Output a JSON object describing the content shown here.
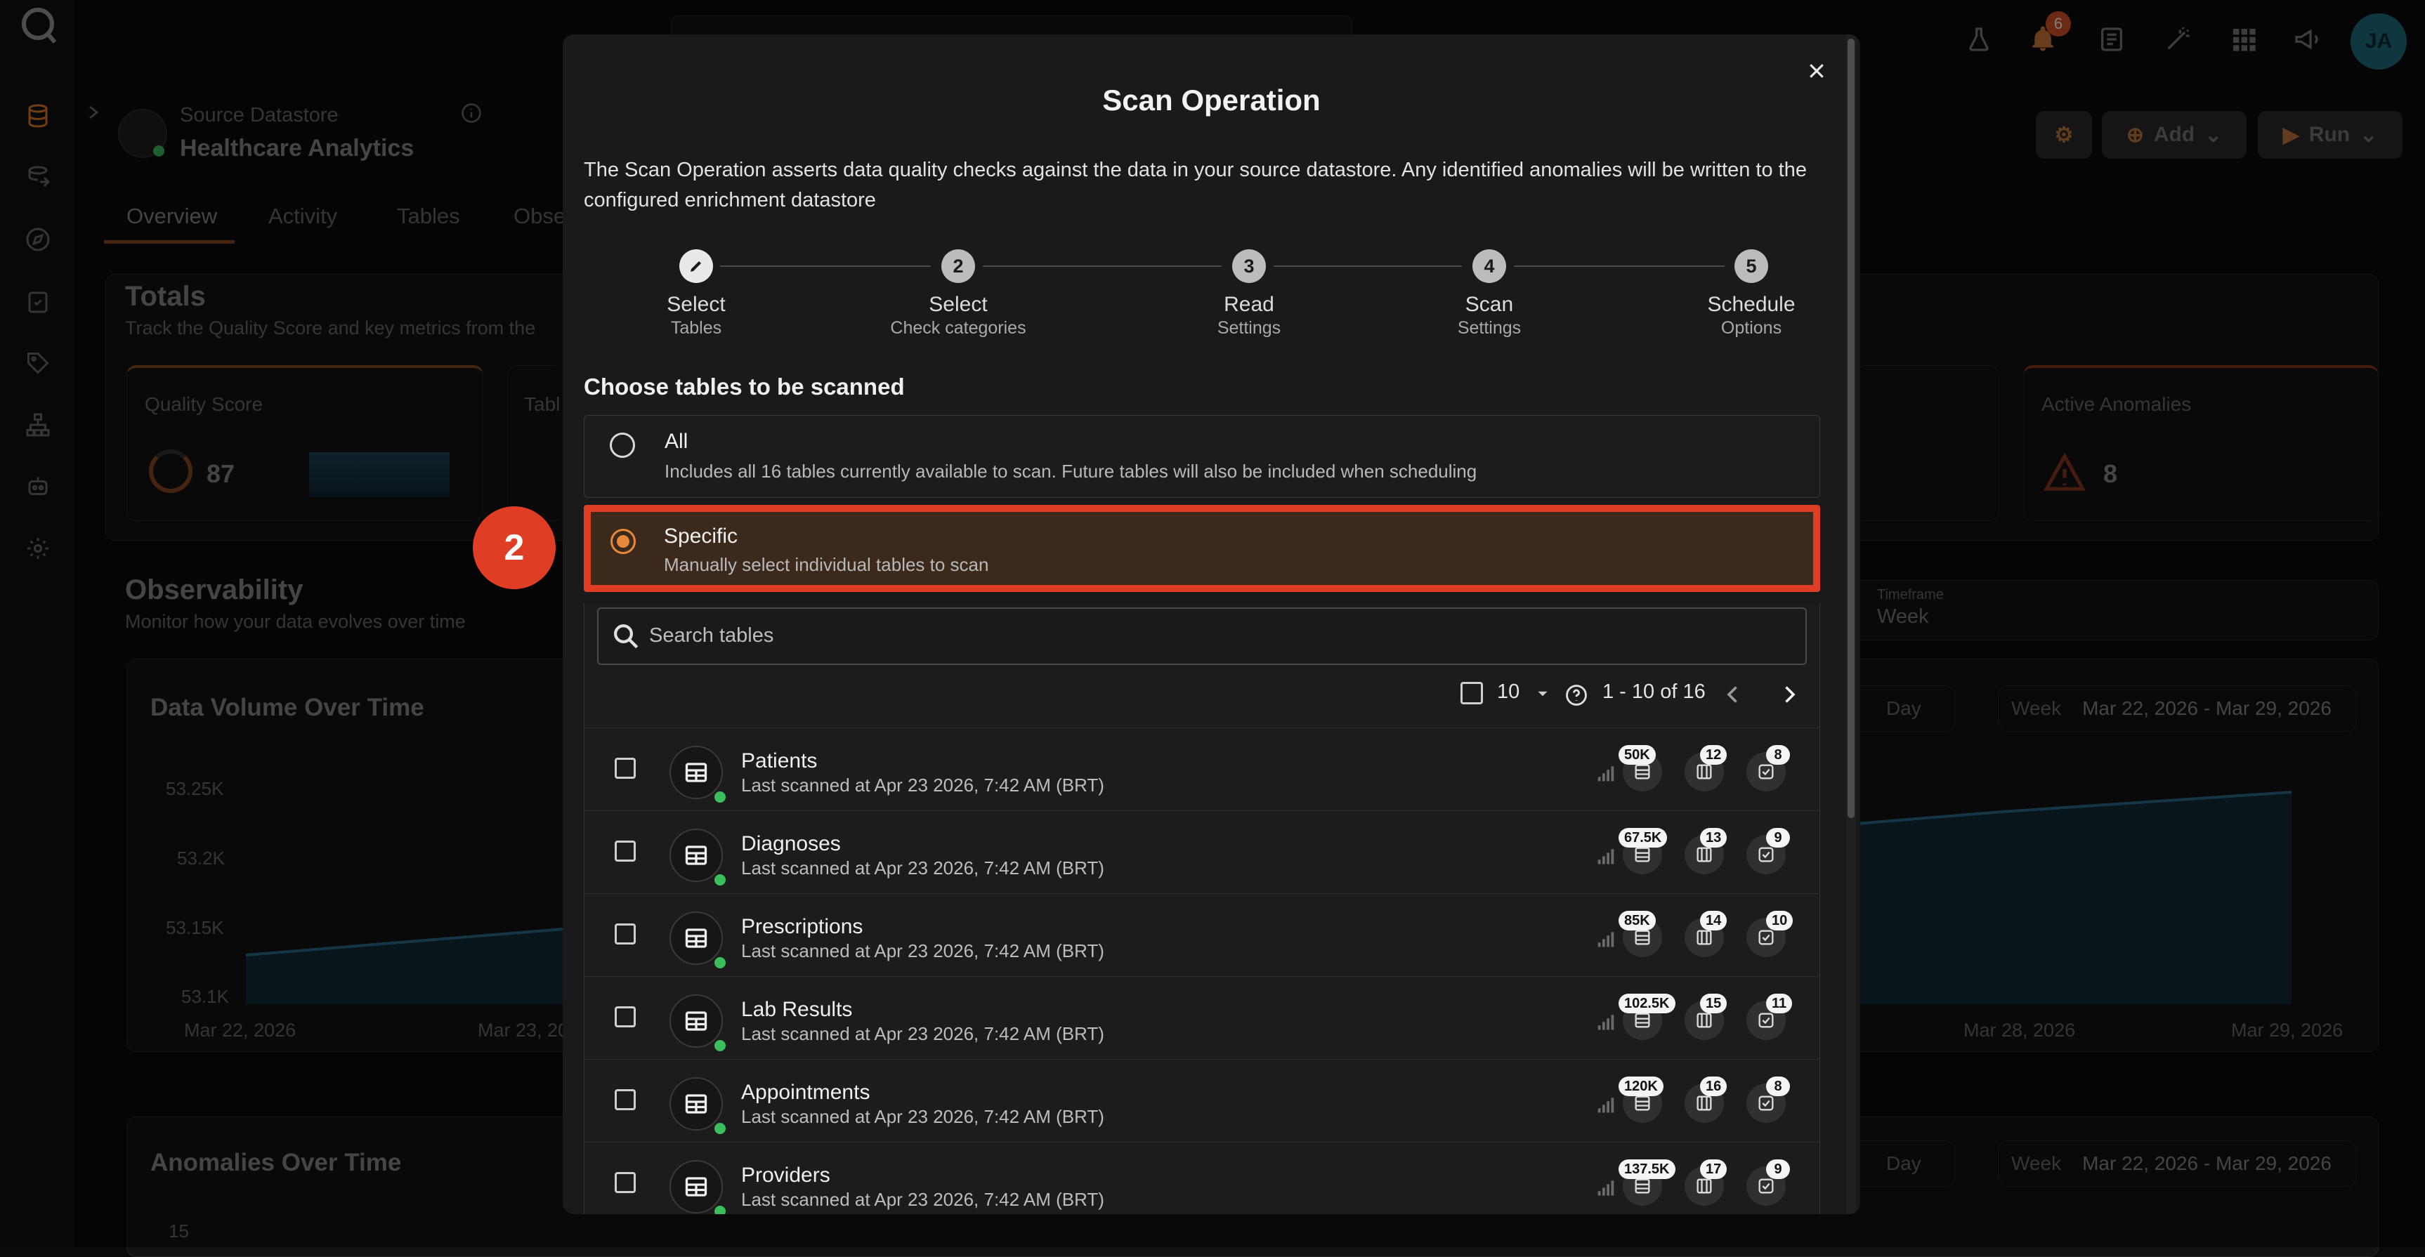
{
  "app": {
    "datastore_label": "Source Datastore",
    "datastore_name": "Healthcare Analytics",
    "tabs": [
      "Overview",
      "Activity",
      "Tables",
      "Obse"
    ],
    "notification_count": "6",
    "avatar_initials": "JA",
    "buttons": {
      "add": "Add",
      "run": "Run"
    },
    "totals_title": "Totals",
    "totals_subtitle": "Track the Quality Score and key metrics from the",
    "quality_score_label": "Quality Score",
    "quality_score_value": "87",
    "tables_card_label": "Tabl",
    "active_anomalies_label": "Active Anomalies",
    "active_anomalies_value": "8",
    "observability_title": "Observability",
    "observability_subtitle": "Monitor how your data evolves over time",
    "timeframe_label": "Timeframe",
    "timeframe_value": "Week",
    "data_volume_title": "Data Volume Over Time",
    "y_ticks": [
      "53.25K",
      "53.2K",
      "53.15K",
      "53.1K"
    ],
    "x_ticks_left": [
      "Mar 22, 2026",
      "Mar 23, 20"
    ],
    "x_ticks_right": [
      "Mar 28, 2026",
      "Mar 29, 2026"
    ],
    "granularity": "Day",
    "range_label": "Week",
    "range_value": "Mar 22, 2026 - Mar 29, 2026",
    "anomalies_title": "Anomalies Over Time",
    "anomalies_y_tick": "15"
  },
  "modal": {
    "title": "Scan Operation",
    "description": "The Scan Operation asserts data quality checks against the data in your source datastore. Any identified anomalies will be written to the configured enrichment datastore",
    "steps": [
      {
        "num": "",
        "title": "Select",
        "sub": "Tables"
      },
      {
        "num": "2",
        "title": "Select",
        "sub": "Check categories"
      },
      {
        "num": "3",
        "title": "Read",
        "sub": "Settings"
      },
      {
        "num": "4",
        "title": "Scan",
        "sub": "Settings"
      },
      {
        "num": "5",
        "title": "Schedule",
        "sub": "Options"
      }
    ],
    "section_title": "Choose tables to be scanned",
    "options": {
      "all": {
        "title": "All",
        "sub": "Includes all 16 tables currently available to scan. Future tables will also be included when scheduling"
      },
      "specific": {
        "title": "Specific",
        "sub": "Manually select individual tables to scan"
      }
    },
    "search_placeholder": "Search tables",
    "page_size": "10",
    "page_range": "1 - 10 of 16",
    "tables": [
      {
        "name": "Patients",
        "meta": "Last scanned at Apr 23 2026, 7:42 AM (BRT)",
        "records": "50K",
        "fields": "12",
        "checks": "8"
      },
      {
        "name": "Diagnoses",
        "meta": "Last scanned at Apr 23 2026, 7:42 AM (BRT)",
        "records": "67.5K",
        "fields": "13",
        "checks": "9"
      },
      {
        "name": "Prescriptions",
        "meta": "Last scanned at Apr 23 2026, 7:42 AM (BRT)",
        "records": "85K",
        "fields": "14",
        "checks": "10"
      },
      {
        "name": "Lab Results",
        "meta": "Last scanned at Apr 23 2026, 7:42 AM (BRT)",
        "records": "102.5K",
        "fields": "15",
        "checks": "11"
      },
      {
        "name": "Appointments",
        "meta": "Last scanned at Apr 23 2026, 7:42 AM (BRT)",
        "records": "120K",
        "fields": "16",
        "checks": "8"
      },
      {
        "name": "Providers",
        "meta": "Last scanned at Apr 23 2026, 7:42 AM (BRT)",
        "records": "137.5K",
        "fields": "17",
        "checks": "9"
      }
    ]
  },
  "callout_number": "2",
  "colors": {
    "accent": "#e8893a",
    "highlight": "#e03e24",
    "status_ok": "#3bbf5a"
  }
}
